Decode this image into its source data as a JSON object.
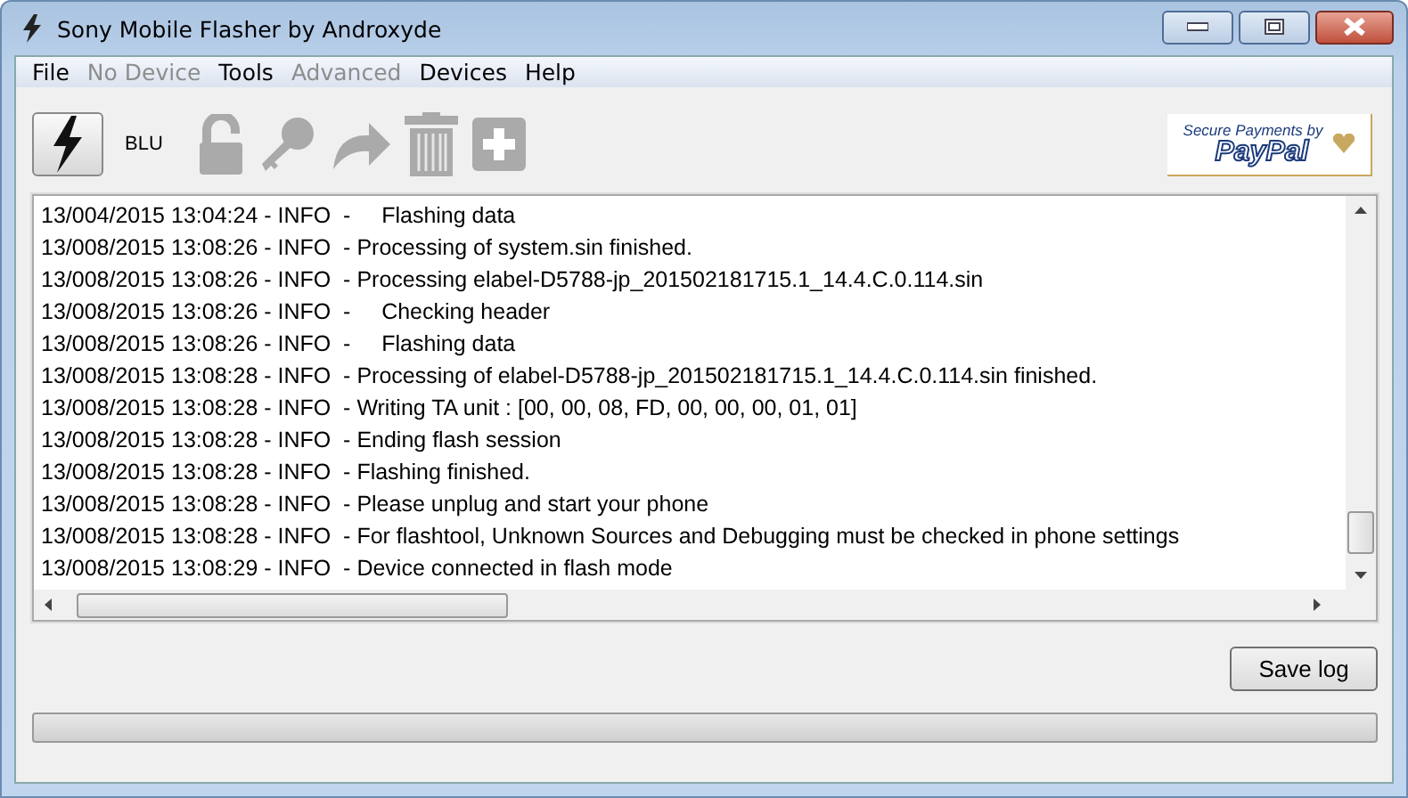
{
  "window": {
    "title": "Sony Mobile Flasher by Androxyde"
  },
  "menu": [
    {
      "label": "File",
      "disabled": false
    },
    {
      "label": "No Device",
      "disabled": true
    },
    {
      "label": "Tools",
      "disabled": false
    },
    {
      "label": "Advanced",
      "disabled": true
    },
    {
      "label": "Devices",
      "disabled": false
    },
    {
      "label": "Help",
      "disabled": false
    }
  ],
  "toolbar": {
    "device_label": "BLU",
    "buttons": [
      {
        "kind": "flash",
        "disabled": false
      },
      {
        "kind": "unlock",
        "disabled": true
      },
      {
        "kind": "key",
        "disabled": true
      },
      {
        "kind": "redo",
        "disabled": true
      },
      {
        "kind": "trash",
        "disabled": true
      },
      {
        "kind": "add",
        "disabled": true
      }
    ]
  },
  "donate": {
    "line_1": "Secure Payments by",
    "line_2": "PayPal"
  },
  "log": [
    "13/004/2015 13:04:24 - INFO  -     Flashing data",
    "13/008/2015 13:08:26 - INFO  - Processing of system.sin finished.",
    "13/008/2015 13:08:26 - INFO  - Processing elabel-D5788-jp_201502181715.1_14.4.C.0.114.sin",
    "13/008/2015 13:08:26 - INFO  -     Checking header",
    "13/008/2015 13:08:26 - INFO  -     Flashing data",
    "13/008/2015 13:08:28 - INFO  - Processing of elabel-D5788-jp_201502181715.1_14.4.C.0.114.sin finished.",
    "13/008/2015 13:08:28 - INFO  - Writing TA unit : [00, 00, 08, FD, 00, 00, 00, 01, 01]",
    "13/008/2015 13:08:28 - INFO  - Ending flash session",
    "13/008/2015 13:08:28 - INFO  - Flashing finished.",
    "13/008/2015 13:08:28 - INFO  - Please unplug and start your phone",
    "13/008/2015 13:08:28 - INFO  - For flashtool, Unknown Sources and Debugging must be checked in phone settings",
    "13/008/2015 13:08:29 - INFO  - Device connected in flash mode"
  ],
  "save_button": "Save log",
  "progress": {
    "level": 0
  }
}
